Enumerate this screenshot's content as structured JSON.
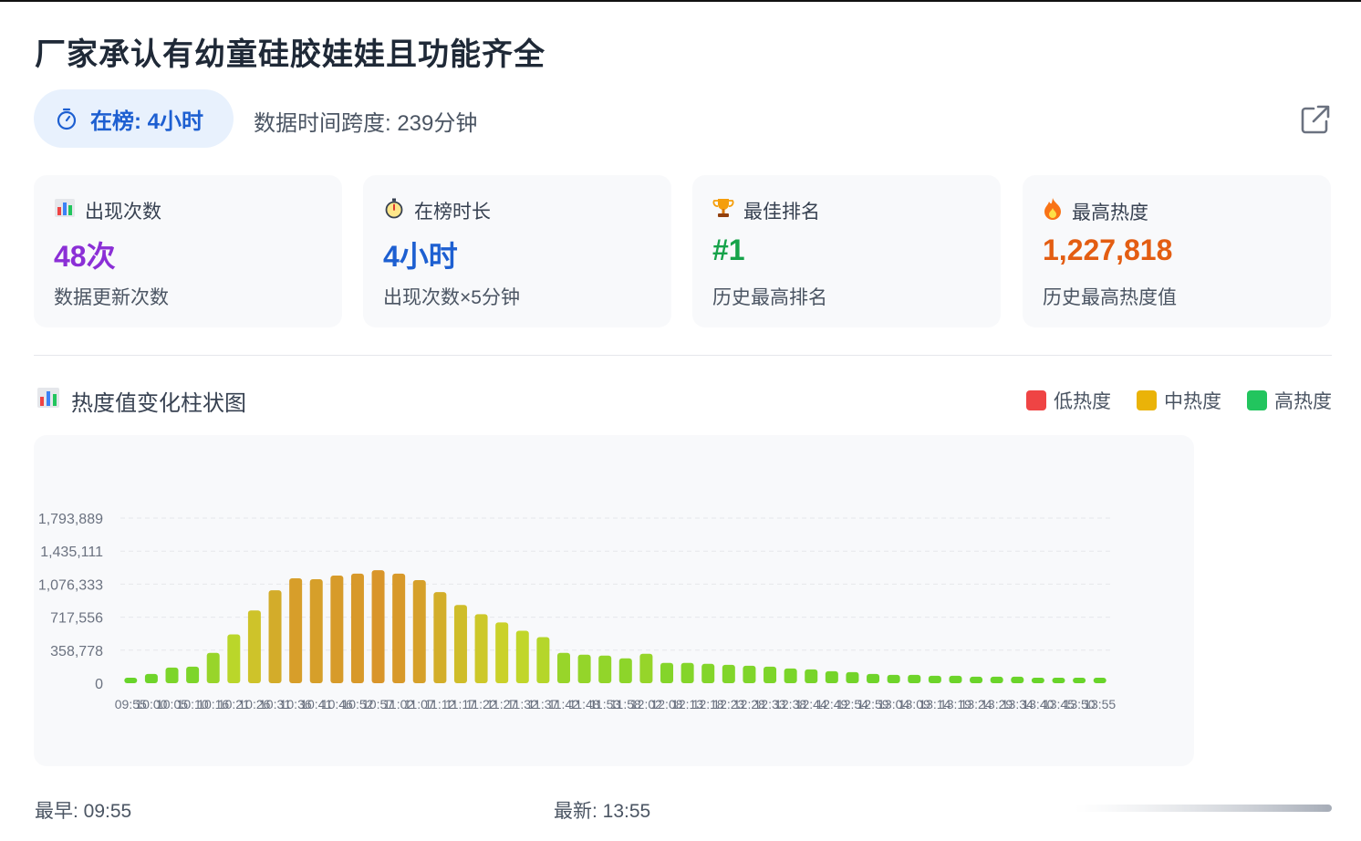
{
  "title": "厂家承认有幼童硅胶娃娃且功能齐全",
  "on_list_pill": "在榜: 4小时",
  "time_span": "数据时间跨度: 239分钟",
  "colors": {
    "accent_blue": "#1d5fd1",
    "purple": "#8b2fd6",
    "blue": "#1d5fd1",
    "green": "#16a34a",
    "orange": "#e35d12",
    "legend_low": "#ef4444",
    "legend_mid": "#eab308",
    "legend_high": "#22c55e"
  },
  "stats": [
    {
      "icon": "bar-chart-icon",
      "label": "出现次数",
      "value": "48次",
      "sub": "数据更新次数"
    },
    {
      "icon": "stopwatch-icon",
      "label": "在榜时长",
      "value": "4小时",
      "sub": "出现次数×5分钟"
    },
    {
      "icon": "trophy-icon",
      "label": "最佳排名",
      "value": "#1",
      "sub": "历史最高排名"
    },
    {
      "icon": "fire-icon",
      "label": "最高热度",
      "value": "1,227,818",
      "sub": "历史最高热度值"
    }
  ],
  "section_title": "热度值变化柱状图",
  "legend": [
    "低热度",
    "中热度",
    "高热度"
  ],
  "footer": {
    "earliest": "最早: 09:55",
    "latest": "最新: 13:55"
  },
  "chart_data": {
    "type": "bar",
    "title": "",
    "xlabel": "",
    "ylabel": "",
    "ylim": [
      0,
      1793889
    ],
    "yticks": [
      0,
      358778,
      717556,
      1076333,
      1435111,
      1793889
    ],
    "ytick_labels": [
      "0",
      "358,778",
      "717,556",
      "1,076,333",
      "1,435,111",
      "1,793,889"
    ],
    "grid": true,
    "legend_position": "top-right",
    "categories": [
      "09:55",
      "10:00",
      "10:05",
      "10:10",
      "10:16",
      "10:21",
      "10:26",
      "10:31",
      "10:36",
      "10:41",
      "10:46",
      "10:52",
      "10:57",
      "11:02",
      "11:07",
      "11:12",
      "11:17",
      "11:22",
      "11:27",
      "11:32",
      "11:37",
      "11:42",
      "11:48",
      "11:53",
      "11:58",
      "12:02",
      "12:08",
      "12:13",
      "12:18",
      "12:23",
      "12:28",
      "12:33",
      "12:38",
      "12:44",
      "12:49",
      "12:54",
      "12:59",
      "13:04",
      "13:09",
      "13:14",
      "13:19",
      "13:24",
      "13:29",
      "13:34",
      "13:40",
      "13:45",
      "13:50",
      "13:55"
    ],
    "values": [
      60000,
      100000,
      170000,
      180000,
      330000,
      530000,
      790000,
      1010000,
      1140000,
      1130000,
      1170000,
      1190000,
      1227818,
      1190000,
      1120000,
      990000,
      850000,
      750000,
      660000,
      570000,
      500000,
      330000,
      310000,
      300000,
      270000,
      320000,
      220000,
      220000,
      210000,
      200000,
      190000,
      180000,
      160000,
      150000,
      130000,
      120000,
      100000,
      90000,
      90000,
      80000,
      80000,
      70000,
      70000,
      70000,
      60000,
      60000,
      60000,
      60000
    ]
  }
}
